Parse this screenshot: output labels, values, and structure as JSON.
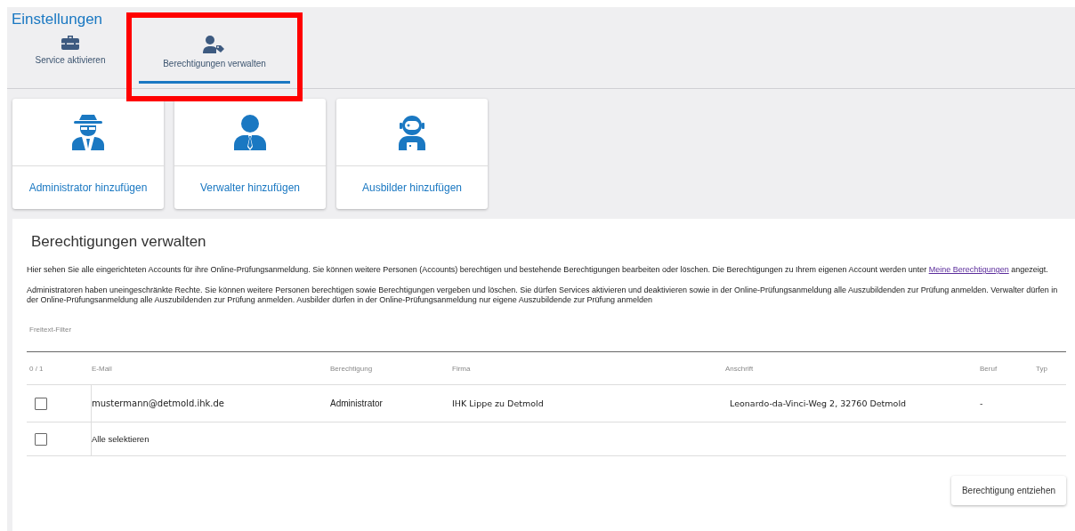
{
  "page_title": "Einstellungen",
  "tabs": [
    {
      "label": "Service aktivieren",
      "selected": false,
      "highlighted": false
    },
    {
      "label": "Berechtigungen verwalten",
      "selected": true,
      "highlighted": true
    }
  ],
  "add_cards": [
    {
      "label": "Administrator hinzufügen"
    },
    {
      "label": "Verwalter hinzufügen"
    },
    {
      "label": "Ausbilder hinzufügen"
    }
  ],
  "section": {
    "title": "Berechtigungen verwalten",
    "paragraphs": [
      {
        "text": "Hier sehen Sie alle eingerichteten Accounts für ihre Online-Prüfungsanmeldung. Sie können weitere Personen (Accounts) berechtigen und bestehende Berechtigungen bearbeiten oder löschen. Die Berechtigungen zu Ihrem eigenen Account werden unter",
        "link": "Meine Berechtigungen",
        "after": "angezeigt."
      },
      {
        "text": "Administratoren haben uneingeschränkte Rechte. Sie können weitere Personen berechtigen sowie Berechtigungen vergeben und löschen. Sie dürfen Services aktivieren und deaktivieren sowie in der Online-Prüfungsanmeldung alle Auszubildenden zur Prüfung anmelden. Verwalter dürfen in der Online-Prüfungsanmeldung alle Auszubildenden zur Prüfung anmelden. Ausbilder dürfen in der Online-Prüfungsanmeldung nur eigene Auszubildende zur Prüfung anmelden"
      }
    ],
    "filter": {
      "placeholder": "Freitext-Filter"
    },
    "table": {
      "columns": [
        "0 / 1",
        "E-Mail",
        "Berechtigung",
        "Firma",
        "Anschrift",
        "Beruf",
        "Typ"
      ],
      "rows": [
        {
          "checked": false,
          "cells": [
            "",
            "mustermann@detmold.ihk.de",
            "Administrator",
            "IHK Lippe zu Detmold",
            "Leonardo-da-Vinci-Weg 2, 32760 Detmold",
            "-"
          ]
        }
      ],
      "select_all": {
        "label": "Alle selektieren",
        "checked": false
      }
    },
    "button": "Berechtigung entziehen"
  }
}
